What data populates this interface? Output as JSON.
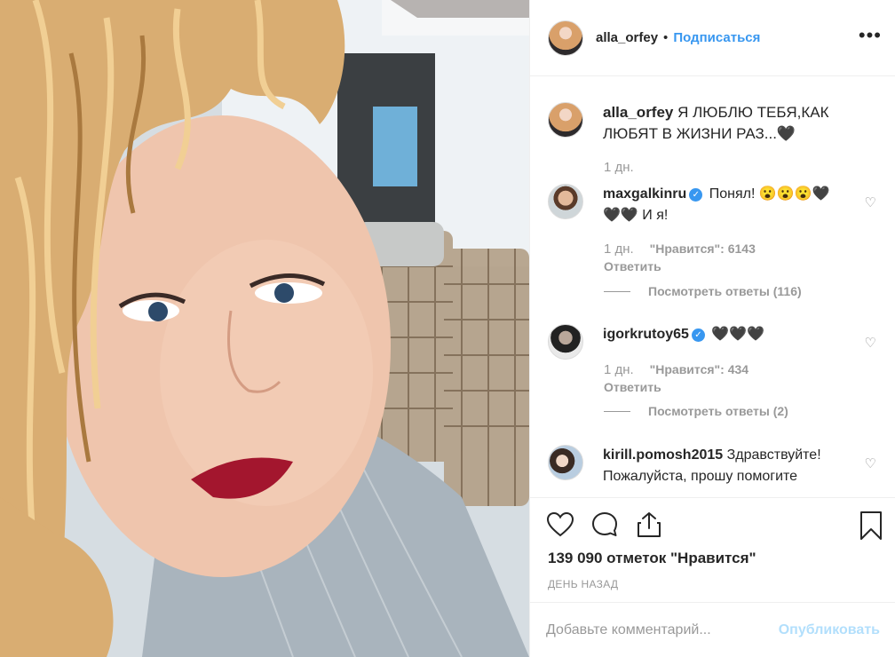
{
  "post": {
    "author": "alla_orfey",
    "dot": "•",
    "follow_label": "Подписаться",
    "more_label": "•••"
  },
  "caption": {
    "author": "alla_orfey",
    "text": "Я ЛЮБЛЮ ТЕБЯ,КАК ЛЮБЯТ В ЖИЗНИ РАЗ...🖤",
    "time": "1 дн."
  },
  "comments": [
    {
      "author": "maxgalkinru",
      "verified": true,
      "text": "Понял! 😮😮😮🖤🖤🖤 И я!",
      "time": "1 дн.",
      "likes": "\"Нравится\": 6143",
      "reply_label": "Ответить",
      "view_replies": "Посмотреть ответы (116)"
    },
    {
      "author": "igorkrutoy65",
      "verified": true,
      "text": "🖤🖤🖤",
      "time": "1 дн.",
      "likes": "\"Нравится\": 434",
      "reply_label": "Ответить",
      "view_replies": "Посмотреть ответы (2)"
    },
    {
      "author": "kirill.pomosh2015",
      "verified": false,
      "text": "Здравствуйте! Пожалуйста, прошу помогите"
    }
  ],
  "likes_total": "139 090 отметок \"Нравится\"",
  "posted_ago": "ДЕНЬ НАЗАД",
  "add_comment": {
    "placeholder": "Добавьте комментарий...",
    "publish_label": "Опубликовать"
  },
  "icons": {
    "like": "heart-outline-icon",
    "comment": "speech-bubble-icon",
    "share": "share-upload-icon",
    "save": "bookmark-icon",
    "comment_like": "small-heart-icon",
    "verified": "verified-badge-icon"
  },
  "colors": {
    "link_blue": "#3897f0",
    "publish_disabled": "#b2dffc",
    "secondary_text": "#999999"
  }
}
